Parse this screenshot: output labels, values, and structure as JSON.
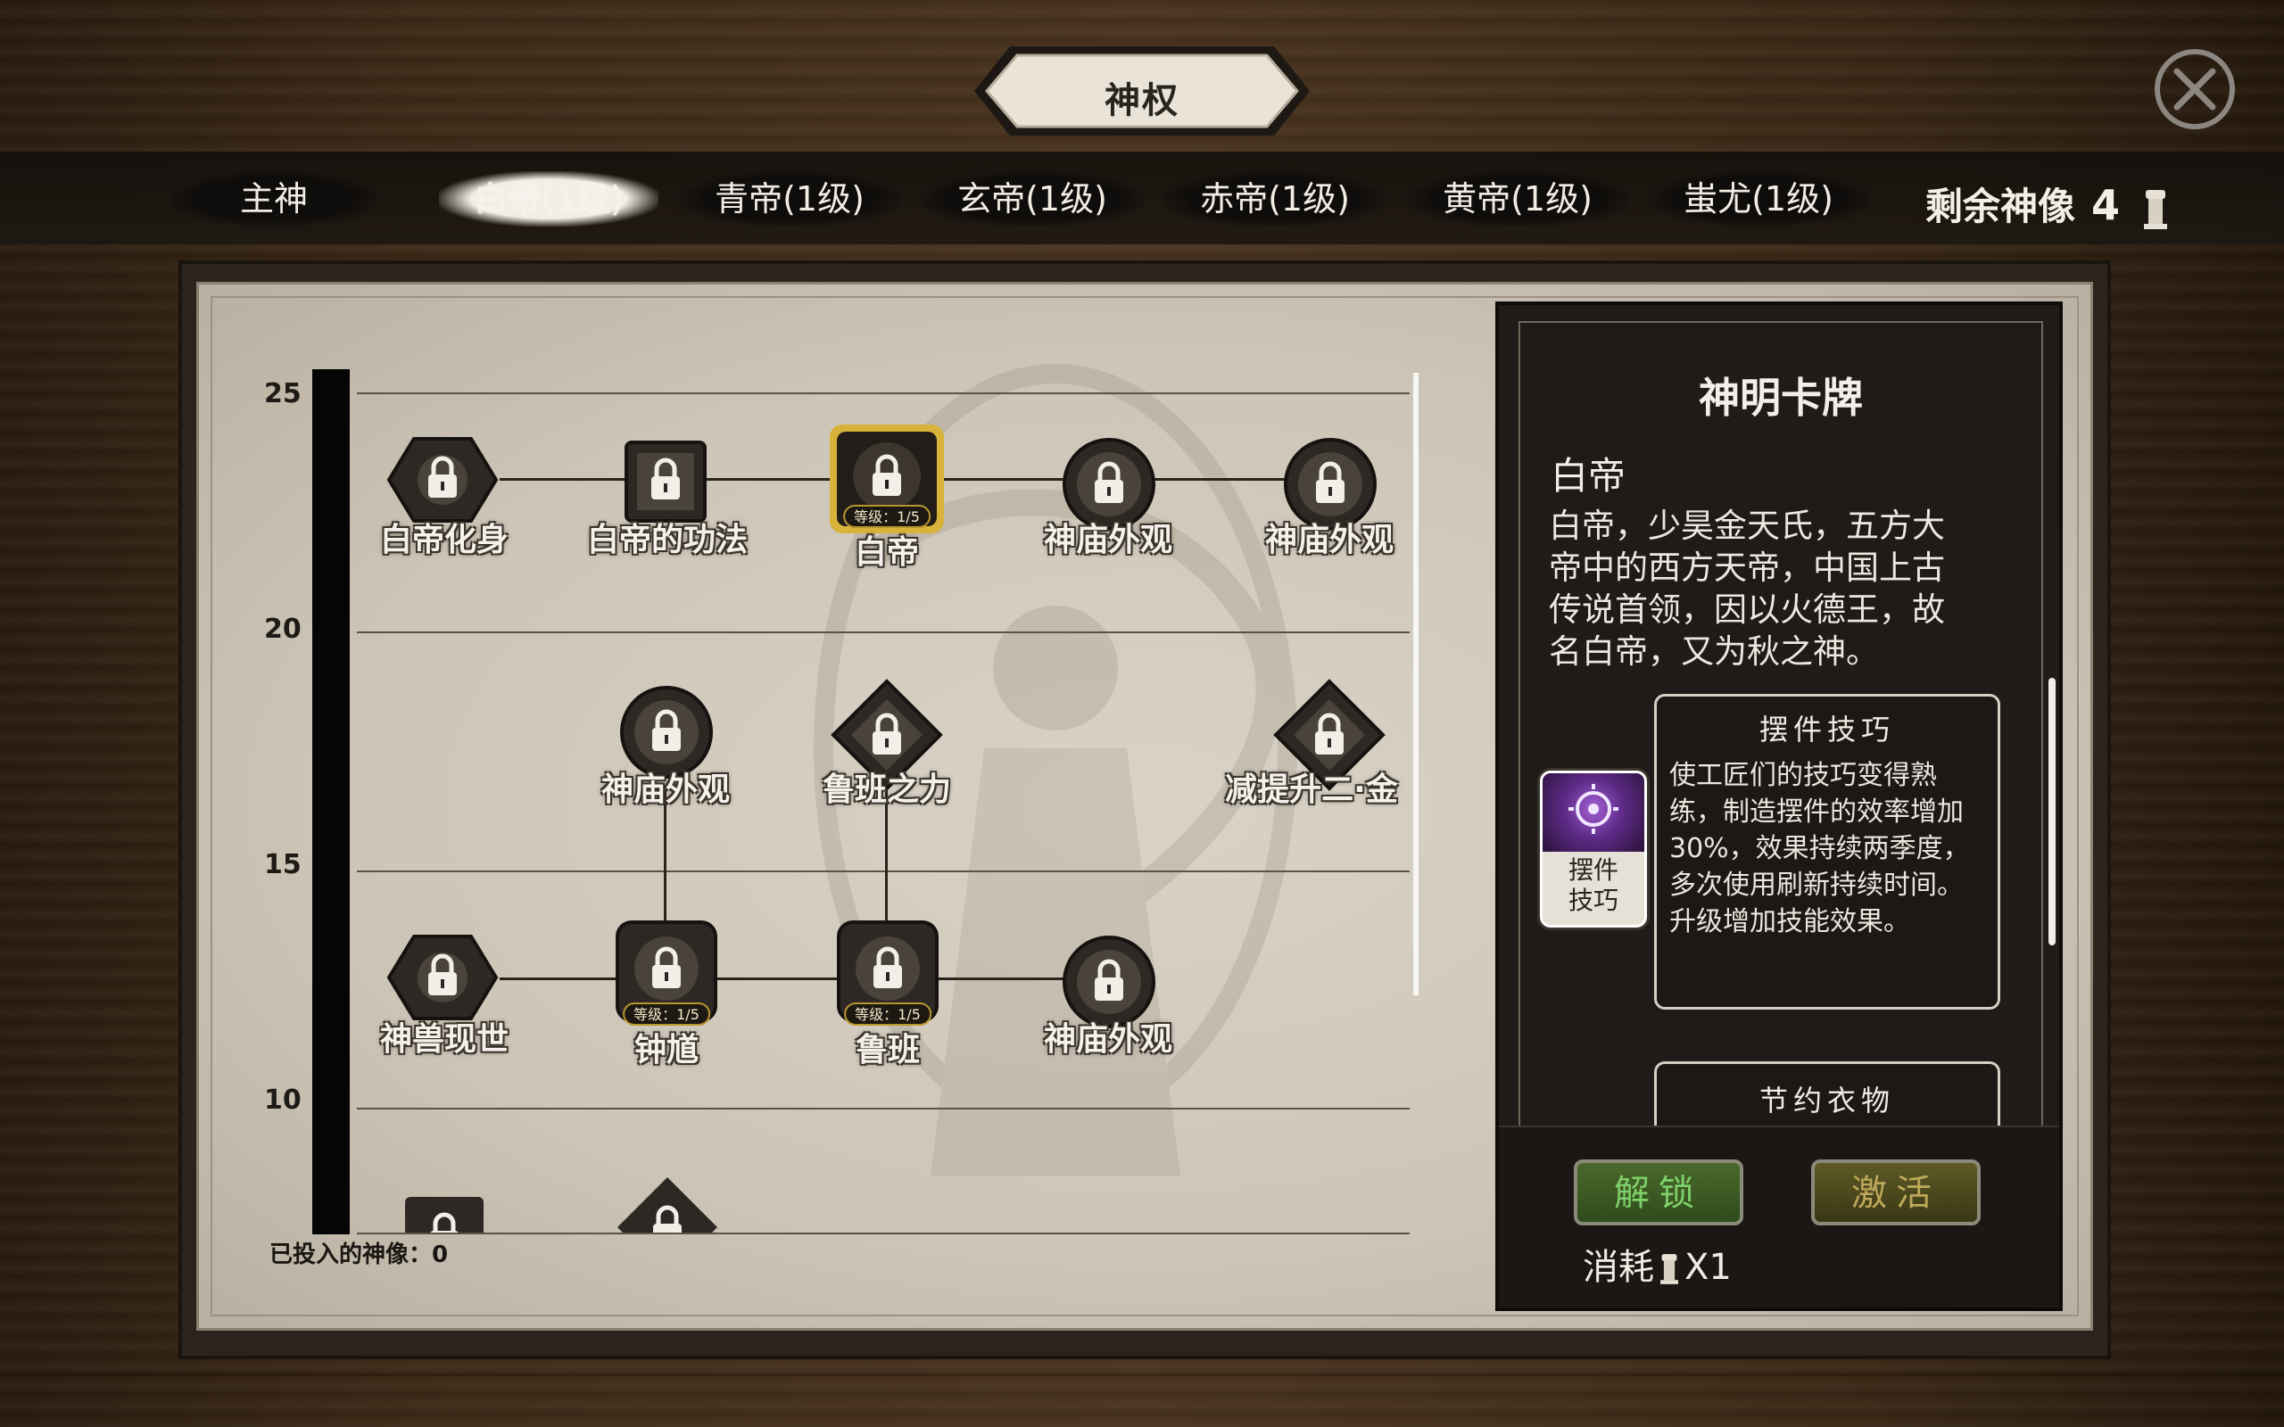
{
  "title": "神权",
  "tabs": [
    {
      "label": "主神",
      "active": false
    },
    {
      "label": "白帝(1级)",
      "active": true
    },
    {
      "label": "青帝(1级)",
      "active": false
    },
    {
      "label": "玄帝(1级)",
      "active": false
    },
    {
      "label": "赤帝(1级)",
      "active": false
    },
    {
      "label": "黄帝(1级)",
      "active": false
    },
    {
      "label": "蚩尤(1级)",
      "active": false
    }
  ],
  "remaining": {
    "label": "剩余神像",
    "count": "4"
  },
  "scale": [
    "25",
    "20",
    "15",
    "10"
  ],
  "nodes": {
    "n1": {
      "label": "白帝化身",
      "icon": "hexagon-lock-icon"
    },
    "n2": {
      "label": "白帝的功法",
      "icon": "square-lock-icon"
    },
    "n3": {
      "label": "白帝",
      "badge": "等级：1/5",
      "icon": "selected-lock-icon"
    },
    "n4": {
      "label": "神庙外观",
      "icon": "circle-lock-icon"
    },
    "n5": {
      "label": "神庙外观",
      "icon": "circle-lock-icon"
    },
    "n6": {
      "label": "神庙外观",
      "icon": "circle-lock-icon"
    },
    "n7": {
      "label": "鲁班之力",
      "icon": "diamond-lock-icon"
    },
    "n8": {
      "label": "减提升二·金",
      "icon": "diamond-lock-icon"
    },
    "n9": {
      "label": "神兽现世",
      "icon": "hexagon-lock-icon"
    },
    "n10": {
      "label": "钟馗",
      "badge": "等级：1/5",
      "icon": "square-lock-icon"
    },
    "n11": {
      "label": "鲁班",
      "badge": "等级：1/5",
      "icon": "square-lock-icon"
    },
    "n12": {
      "label": "神庙外观",
      "icon": "circle-lock-icon"
    }
  },
  "invested": "已投入的神像：0",
  "panel": {
    "title": "神明卡牌",
    "god_name": "白帝",
    "god_desc": "白帝，少昊金天氏，五方大帝中的西方天帝，中国上古传说首领，因以火德王，故名白帝，又为秋之神。",
    "card_label": "摆件\n技巧",
    "skill1_title": "摆件技巧",
    "skill1_desc": "使工匠们的技巧变得熟练，制造摆件的效率增加30%，效果持续两季度，多次使用刷新持续时间。升级增加技能效果。",
    "skill2_title": "节约衣物",
    "unlock_label": "解锁",
    "activate_label": "激活",
    "cost_label": "消耗",
    "cost_value": "X1"
  },
  "colors": {
    "unlock": "#4a6a2c",
    "activate": "#5e5a26",
    "badge_border": "#b8962e",
    "selected_glow": "#d8b33a"
  }
}
